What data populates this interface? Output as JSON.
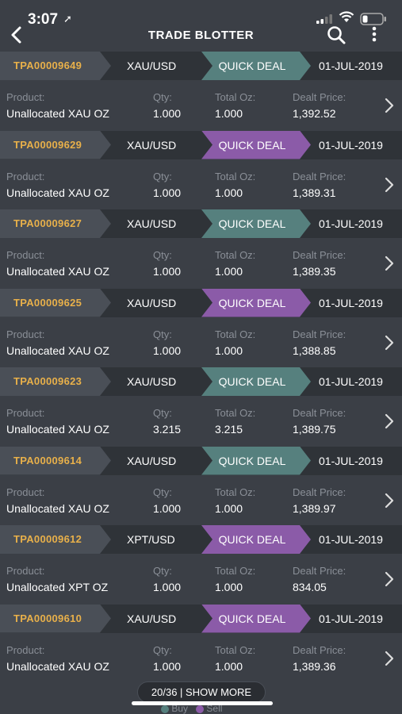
{
  "status": {
    "time": "3:07",
    "location_glyph": "➚"
  },
  "header": {
    "title": "TRADE BLOTTER",
    "back_icon": "chevron-left-icon",
    "search_icon": "search-icon",
    "menu_icon": "more-vertical-icon"
  },
  "labels": {
    "product": "Product:",
    "qty": "Qty:",
    "total_oz": "Total Oz:",
    "dealt_price": "Dealt Price:"
  },
  "colors": {
    "buy": "#56807e",
    "sell": "#8b5ba8",
    "ref": "#e8b04a"
  },
  "trades": [
    {
      "ref": "TPA00009649",
      "pair": "XAU/USD",
      "deal": "QUICK DEAL",
      "side": "buy",
      "date": "01-JUL-2019",
      "product": "Unallocated XAU OZ",
      "qty": "1.000",
      "total_oz": "1.000",
      "price": "1,392.52"
    },
    {
      "ref": "TPA00009629",
      "pair": "XAU/USD",
      "deal": "QUICK DEAL",
      "side": "sell",
      "date": "01-JUL-2019",
      "product": "Unallocated XAU OZ",
      "qty": "1.000",
      "total_oz": "1.000",
      "price": "1,389.31"
    },
    {
      "ref": "TPA00009627",
      "pair": "XAU/USD",
      "deal": "QUICK DEAL",
      "side": "buy",
      "date": "01-JUL-2019",
      "product": "Unallocated XAU OZ",
      "qty": "1.000",
      "total_oz": "1.000",
      "price": "1,389.35"
    },
    {
      "ref": "TPA00009625",
      "pair": "XAU/USD",
      "deal": "QUICK DEAL",
      "side": "sell",
      "date": "01-JUL-2019",
      "product": "Unallocated XAU OZ",
      "qty": "1.000",
      "total_oz": "1.000",
      "price": "1,388.85"
    },
    {
      "ref": "TPA00009623",
      "pair": "XAU/USD",
      "deal": "QUICK DEAL",
      "side": "buy",
      "date": "01-JUL-2019",
      "product": "Unallocated XAU OZ",
      "qty": "3.215",
      "total_oz": "3.215",
      "price": "1,389.75"
    },
    {
      "ref": "TPA00009614",
      "pair": "XAU/USD",
      "deal": "QUICK DEAL",
      "side": "buy",
      "date": "01-JUL-2019",
      "product": "Unallocated XAU OZ",
      "qty": "1.000",
      "total_oz": "1.000",
      "price": "1,389.97"
    },
    {
      "ref": "TPA00009612",
      "pair": "XPT/USD",
      "deal": "QUICK DEAL",
      "side": "sell",
      "date": "01-JUL-2019",
      "product": "Unallocated XPT OZ",
      "qty": "1.000",
      "total_oz": "1.000",
      "price": "834.05"
    },
    {
      "ref": "TPA00009610",
      "pair": "XAU/USD",
      "deal": "QUICK DEAL",
      "side": "sell",
      "date": "01-JUL-2019",
      "product": "Unallocated XAU OZ",
      "qty": "1.000",
      "total_oz": "1.000",
      "price": "1,389.36"
    }
  ],
  "footer": {
    "show_more": "20/36 | SHOW MORE",
    "legend_buy": "Buy",
    "legend_sell": "Sell"
  }
}
